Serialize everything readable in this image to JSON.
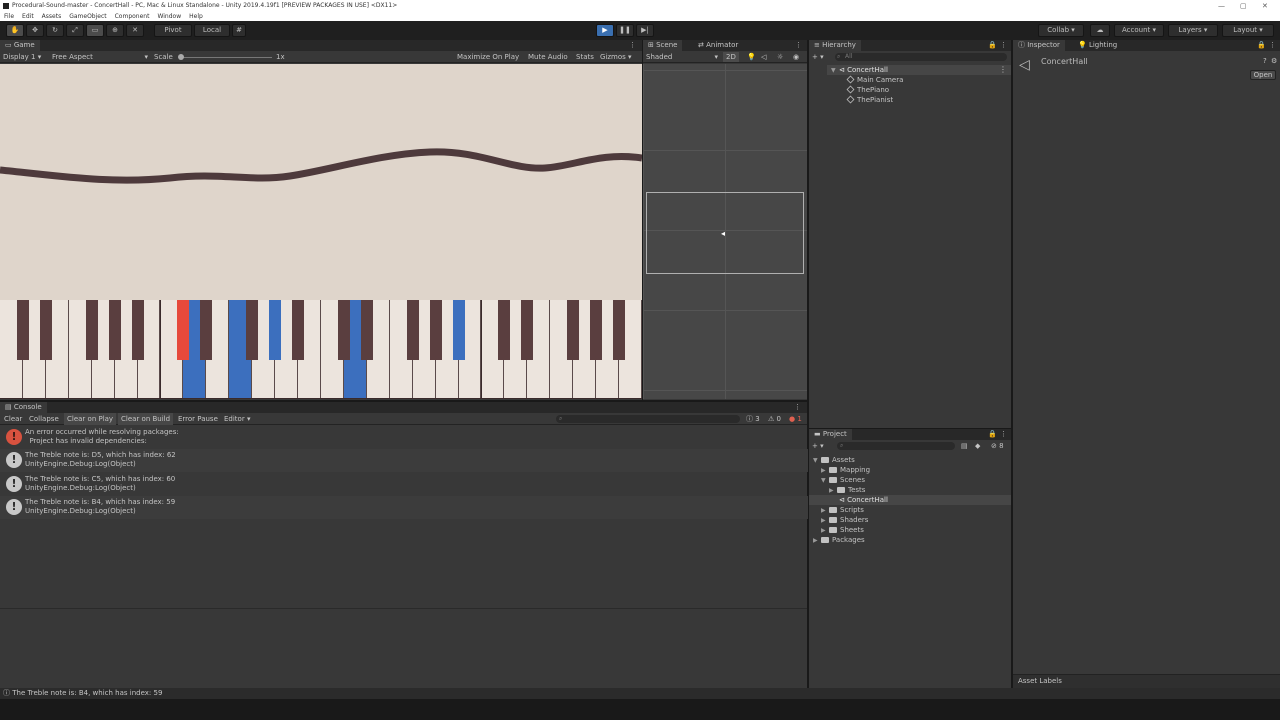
{
  "window": {
    "title": "Procedural-Sound-master - ConcertHall - PC, Mac & Linux Standalone - Unity 2019.4.19f1 [PREVIEW PACKAGES IN USE] <DX11>"
  },
  "menu": [
    "File",
    "Edit",
    "Assets",
    "GameObject",
    "Component",
    "Window",
    "Help"
  ],
  "toolbar": {
    "pivot": "Pivot",
    "local": "Local",
    "collab": "Collab",
    "account": "Account",
    "layers": "Layers",
    "layout": "Layout"
  },
  "game": {
    "tab": "Game",
    "display": "Display 1",
    "aspect": "Free Aspect",
    "scale_label": "Scale",
    "scale_value": "1x",
    "maximize": "Maximize On Play",
    "mute": "Mute Audio",
    "stats": "Stats",
    "gizmos": "Gizmos",
    "highlighted_keys": {
      "red_black": [
        5
      ],
      "blue_white": [
        8,
        10,
        15
      ],
      "blue_black": [
        8,
        14
      ]
    }
  },
  "scene": {
    "tab": "Scene",
    "animator_tab": "Animator",
    "shading": "Shaded",
    "mode2d": "2D"
  },
  "hierarchy": {
    "tab": "Hierarchy",
    "search_placeholder": "All",
    "root": "ConcertHall",
    "children": [
      "Main Camera",
      "ThePiano",
      "ThePianist"
    ]
  },
  "inspector": {
    "tab": "Inspector",
    "lighting_tab": "Lighting",
    "object": "ConcertHall",
    "open_button": "Open",
    "asset_labels": "Asset Labels"
  },
  "console": {
    "tab": "Console",
    "buttons": [
      "Clear",
      "Collapse",
      "Clear on Play",
      "Clear on Build",
      "Error Pause",
      "Editor"
    ],
    "counts": {
      "log": "3",
      "warn": "0",
      "error": "1"
    },
    "entries": [
      {
        "type": "error",
        "line1": "An error occurred while resolving packages:",
        "line2": "  Project has invalid dependencies:"
      },
      {
        "type": "log",
        "line1": "The Treble note is: D5, which has index: 62",
        "line2": "UnityEngine.Debug:Log(Object)"
      },
      {
        "type": "log",
        "line1": "The Treble note is: C5, which has index: 60",
        "line2": "UnityEngine.Debug:Log(Object)"
      },
      {
        "type": "log",
        "line1": "The Treble note is: B4, which has index: 59",
        "line2": "UnityEngine.Debug:Log(Object)"
      }
    ]
  },
  "project": {
    "tab": "Project",
    "visible_count": "8",
    "tree": {
      "assets": "Assets",
      "mapping": "Mapping",
      "scenes": "Scenes",
      "tests": "Tests",
      "concerthall": "ConcertHall",
      "scripts": "Scripts",
      "shaders": "Shaders",
      "sheets": "Sheets",
      "packages": "Packages"
    }
  },
  "statusbar": {
    "message": "The Treble note is: B4, which has index: 59"
  },
  "colors": {
    "accent": "#3a6fb0",
    "key_blue": "#3c6fbe",
    "key_red": "#e6493b",
    "bg": "#dfd5cb",
    "wave": "#4e3a3c"
  }
}
